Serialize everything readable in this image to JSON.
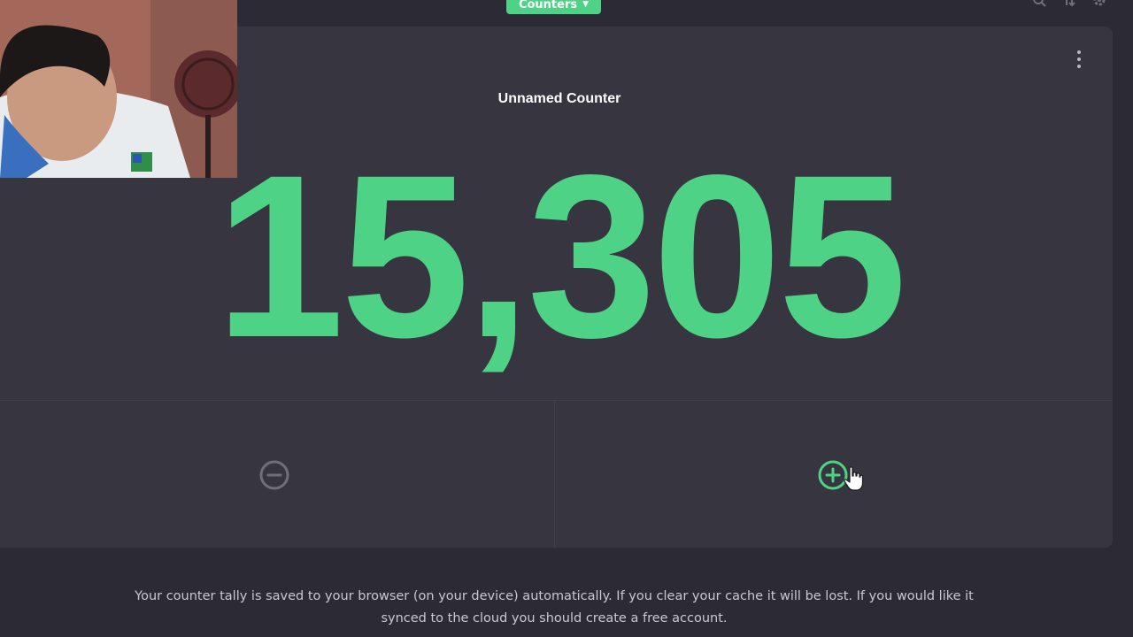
{
  "header": {
    "menu_label": "Counters",
    "menu_icon": "chevron-down-icon",
    "right_icons": [
      "search-icon",
      "sort-icon",
      "gear-icon"
    ]
  },
  "counter": {
    "title": "Unnamed Counter",
    "value": "15,305",
    "menu_icon": "kebab-menu-icon",
    "decrement_icon": "minus-circle-icon",
    "increment_icon": "plus-circle-icon"
  },
  "notice": {
    "text": "Your counter tally is saved to your browser (on your device) automatically. If you clear your cache it will be lost. If you would like it synced to the cloud you should create a free account."
  },
  "colors": {
    "accent": "#4ed286",
    "background": "#2c2b35",
    "card": "#363540",
    "muted_icon": "#6f6e7a"
  }
}
